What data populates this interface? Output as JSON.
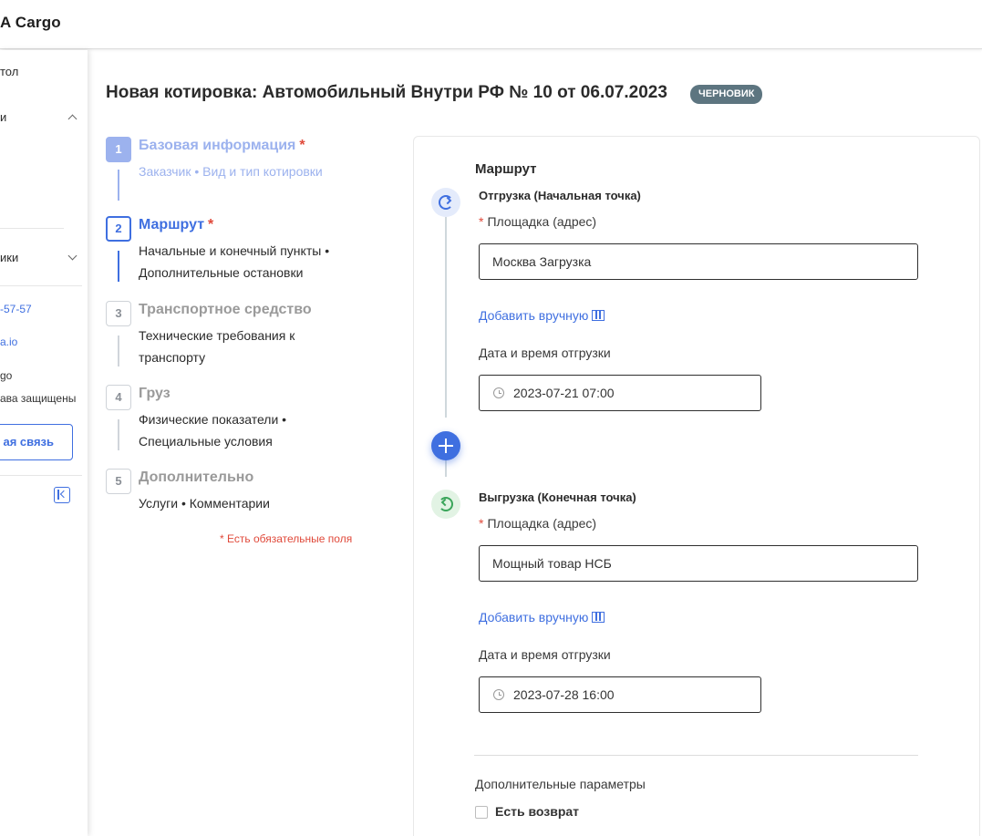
{
  "app": {
    "logo": "A Cargo"
  },
  "sidebar": {
    "items": [
      {
        "label": "тол"
      },
      {
        "label": "и"
      },
      {
        "label": "ики"
      }
    ],
    "phone": "-57-57",
    "email": "a.io",
    "company": "go",
    "copyright": "ава защищены",
    "feedback_label": "ая связь"
  },
  "page": {
    "title": "Новая котировка: Автомобильный Внутри РФ № 10 от 06.07.2023",
    "status_badge": "ЧЕРНОВИК"
  },
  "steps": [
    {
      "num": "1",
      "title": "Базовая информация",
      "required": "*",
      "desc": "Заказчик • Вид и тип котировки",
      "state": "done"
    },
    {
      "num": "2",
      "title": "Маршрут",
      "required": "*",
      "desc": "Начальные и конечный пункты • Дополнительные остановки",
      "state": "active"
    },
    {
      "num": "3",
      "title": "Транспортное средство",
      "required": "",
      "desc": "Технические требования к транспорту",
      "state": "pending"
    },
    {
      "num": "4",
      "title": "Груз",
      "required": "",
      "desc": "Физические показатели • Специальные условия",
      "state": "pending"
    },
    {
      "num": "5",
      "title": "Дополнительно",
      "required": "",
      "desc": "Услуги • Комментарии",
      "state": "pending"
    }
  ],
  "required_note": "* Есть обязательные поля",
  "route": {
    "title": "Маршрут",
    "origin": {
      "subtitle": "Отгрузка (Начальная точка)",
      "site_label": "Площадка (адрес)",
      "site_value": "Москва Загрузка",
      "add_manual": "Добавить вручную",
      "datetime_label": "Дата и время отгрузки",
      "datetime_value": "2023-07-21 07:00"
    },
    "destination": {
      "subtitle": "Выгрузка (Конечная точка)",
      "site_label": "Площадка (адрес)",
      "site_value": "Мощный товар НСБ",
      "add_manual": "Добавить вручную",
      "datetime_label": "Дата и время отгрузки",
      "datetime_value": "2023-07-28 16:00"
    },
    "extra_params_title": "Дополнительные параметры",
    "return_checkbox_label": "Есть возврат",
    "return_checked": false
  },
  "colors": {
    "accent": "#3f6fe0",
    "badge": "#5d7580",
    "required": "#e0493a",
    "done_step": "#9cb2ee",
    "success": "#3aa55a"
  }
}
